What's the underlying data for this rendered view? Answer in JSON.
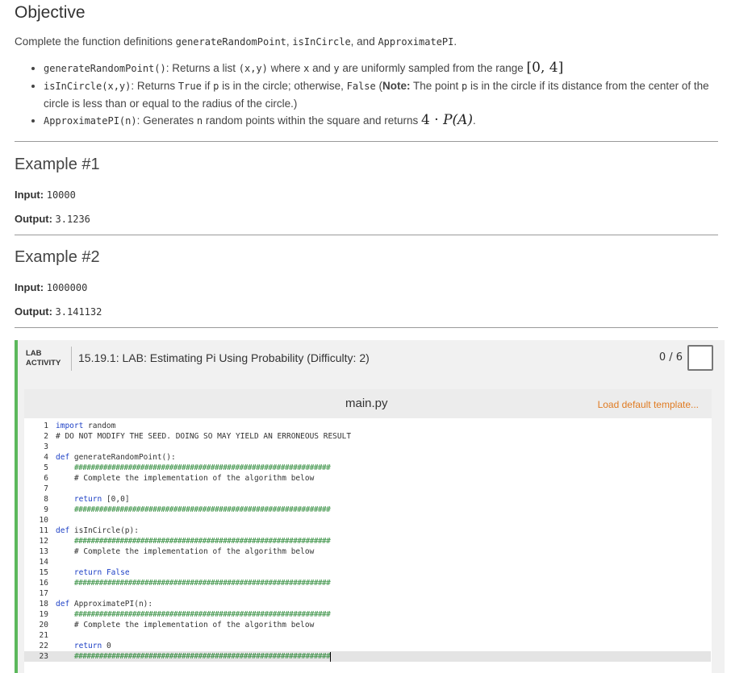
{
  "objective": {
    "title": "Objective",
    "intro_prefix": "Complete the function definitions ",
    "fn1": "generateRandomPoint",
    "sep1": ", ",
    "fn2": "isInCircle",
    "sep2": ", and ",
    "fn3": "ApproximatePI",
    "intro_suffix": ".",
    "bullets": [
      {
        "code": "generateRandomPoint()",
        "text_a": ": Returns a list ",
        "code2": "(x,y)",
        "text_b": " where ",
        "code3": "x",
        "text_c": " and ",
        "code4": "y",
        "text_d": " are uniformly sampled from the range ",
        "math": "[0, 4]"
      },
      {
        "code": "isInCircle(x,y)",
        "text_a": ": Returns ",
        "code2": "True",
        "text_b": " if ",
        "code3": "p",
        "text_c": " is in the circle; otherwise, ",
        "code4": "False",
        "text_d": " (",
        "note_bold": "Note:",
        "text_e": " The point ",
        "code5": "p",
        "text_f": " is in the circle if its distance from the center of the circle is less than or equal to the radius of the circle.)"
      },
      {
        "code": "ApproximatePI(n)",
        "text_a": ": Generates ",
        "code2": "n",
        "text_b": " random points within the square and returns ",
        "math_a": "4 · ",
        "math_b": "P(A)",
        "text_c": "."
      }
    ]
  },
  "examples": [
    {
      "title": "Example #1",
      "input_label": "Input:",
      "input_value": "10000",
      "output_label": "Output:",
      "output_value": "3.1236"
    },
    {
      "title": "Example #2",
      "input_label": "Input:",
      "input_value": "1000000",
      "output_label": "Output:",
      "output_value": "3.141132"
    }
  ],
  "lab": {
    "tag_line1": "LAB",
    "tag_line2": "ACTIVITY",
    "title": "15.19.1: LAB: Estimating Pi Using Probability (Difficulty: 2)",
    "score": "0 / 6",
    "accent_color": "#5cb85c",
    "check_icon": "checkbox-icon"
  },
  "editor": {
    "file_name": "main.py",
    "load_template": "Load default template...",
    "lines": [
      {
        "n": "1",
        "kw": "import",
        "rest": " random"
      },
      {
        "n": "2",
        "text": "# DO NOT MODIFY THE SEED. DOING SO MAY YIELD AN ERRONEOUS RESULT"
      },
      {
        "n": "3",
        "text": ""
      },
      {
        "n": "4",
        "kw": "def",
        "rest": " generateRandomPoint():"
      },
      {
        "n": "5",
        "indent": "    ",
        "hash": "##############################################################"
      },
      {
        "n": "6",
        "text": "    # Complete the implementation of the algorithm below"
      },
      {
        "n": "7",
        "text": ""
      },
      {
        "n": "8",
        "indent": "    ",
        "kw2": "return",
        "rest2": " [0,0]"
      },
      {
        "n": "9",
        "indent": "    ",
        "hash": "##############################################################"
      },
      {
        "n": "10",
        "text": ""
      },
      {
        "n": "11",
        "kw": "def",
        "rest": " isInCircle(p):"
      },
      {
        "n": "12",
        "indent": "    ",
        "hash": "##############################################################"
      },
      {
        "n": "13",
        "text": "    # Complete the implementation of the algorithm below"
      },
      {
        "n": "14",
        "text": ""
      },
      {
        "n": "15",
        "indent": "    ",
        "kw2": "return",
        "lit": " False"
      },
      {
        "n": "16",
        "indent": "    ",
        "hash": "##############################################################"
      },
      {
        "n": "17",
        "text": ""
      },
      {
        "n": "18",
        "kw": "def",
        "rest": " ApproximatePI(n):"
      },
      {
        "n": "19",
        "indent": "    ",
        "hash": "##############################################################"
      },
      {
        "n": "20",
        "text": "    # Complete the implementation of the algorithm below"
      },
      {
        "n": "21",
        "text": ""
      },
      {
        "n": "22",
        "indent": "    ",
        "kw2": "return",
        "rest2": " 0"
      },
      {
        "n": "23",
        "indent": "    ",
        "hash": "##############################################################"
      }
    ]
  }
}
